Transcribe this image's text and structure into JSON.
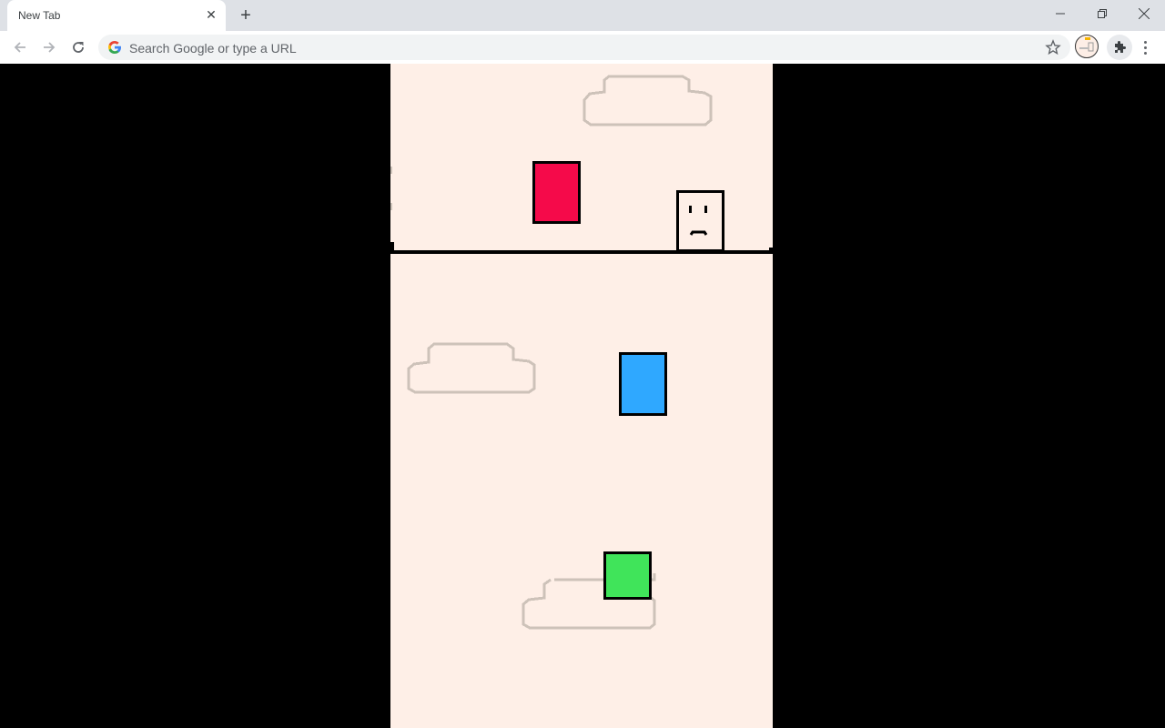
{
  "browser": {
    "tab": {
      "title": "New Tab",
      "close_icon": "close-icon"
    },
    "new_tab_icon": "plus-icon",
    "window_controls": [
      "minimize-icon",
      "restore-icon",
      "close-icon"
    ],
    "nav": [
      "back-icon",
      "forward-icon",
      "reload-icon"
    ],
    "omnibox": {
      "placeholder": "Search Google or type a URL",
      "value": ""
    }
  },
  "game": {
    "background_color": "#feefe7",
    "platform_color": "#000000",
    "cloud_color": "#cdc2b9",
    "blocks": [
      {
        "name": "red-block",
        "color": "#f50a4a"
      },
      {
        "name": "blue-block",
        "color": "#2fa8ff"
      },
      {
        "name": "green-block",
        "color": "#40e45a"
      }
    ],
    "player": {
      "name": "player-sad-face",
      "color": "#feefe7",
      "expression": "sad"
    },
    "clouds": 3
  }
}
